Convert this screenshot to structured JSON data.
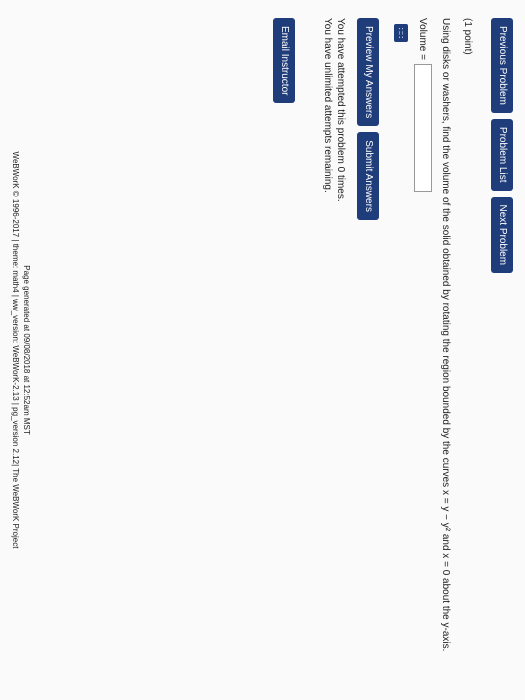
{
  "nav": {
    "previous": "Previous Problem",
    "list": "Problem List",
    "next": "Next Problem"
  },
  "problem": {
    "points": "(1 point)",
    "statement": "Using disks or washers, find the volume of the solid obtained by rotating the region bounded by the curves x = y − y² and x = 0 about the y-axis.",
    "volume_label": "Volume =",
    "volume_value": "",
    "math_icon": "∷∷"
  },
  "actions": {
    "preview": "Preview My Answers",
    "submit": "Submit Answers"
  },
  "attempts": {
    "line1": "You have attempted this problem 0 times.",
    "line2": "You have unlimited attempts remaining."
  },
  "email": {
    "label": "Email Instructor"
  },
  "footer": {
    "generated": "Page generated at 09/08/2018 at 12:52am MST",
    "copyright": "WeBWorK © 1996-2017 | theme: math4 | ww_version: WeBWorK-2.13 | pg_version 2.12| The WeBWorK Project"
  },
  "colors": {
    "button": "#1f3d7a"
  }
}
